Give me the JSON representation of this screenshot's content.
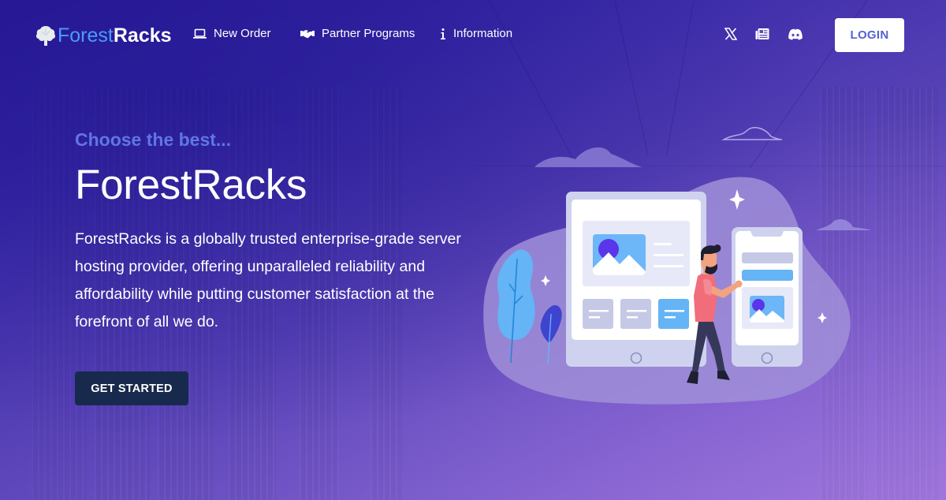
{
  "brand": {
    "name_part1": "Forest",
    "name_part2": "Racks",
    "logo_icon": "tree-icon"
  },
  "nav": {
    "links": [
      {
        "label": "New Order",
        "icon": "laptop-icon"
      },
      {
        "label": "Partner Programs",
        "icon": "handshake-icon"
      },
      {
        "label": "Information",
        "icon": "info-icon"
      }
    ],
    "social": [
      {
        "name": "x-twitter-icon"
      },
      {
        "name": "newspaper-icon"
      },
      {
        "name": "discord-icon"
      }
    ],
    "login_label": "LOGIN"
  },
  "hero": {
    "tagline": "Choose the best...",
    "title": "ForestRacks",
    "description": "ForestRacks is a globally trusted enterprise-grade server hosting provider, offering unparalleled reliability and affordability while putting customer satisfaction at the forefront of all we do.",
    "cta_label": "GET STARTED"
  },
  "colors": {
    "accent_blue": "#4a9cf5",
    "tagline": "#6076e2",
    "login_text": "#5463d0",
    "cta_bg": "#172a4d",
    "bg_start": "#2a1a9a",
    "bg_end": "#9570d8"
  }
}
